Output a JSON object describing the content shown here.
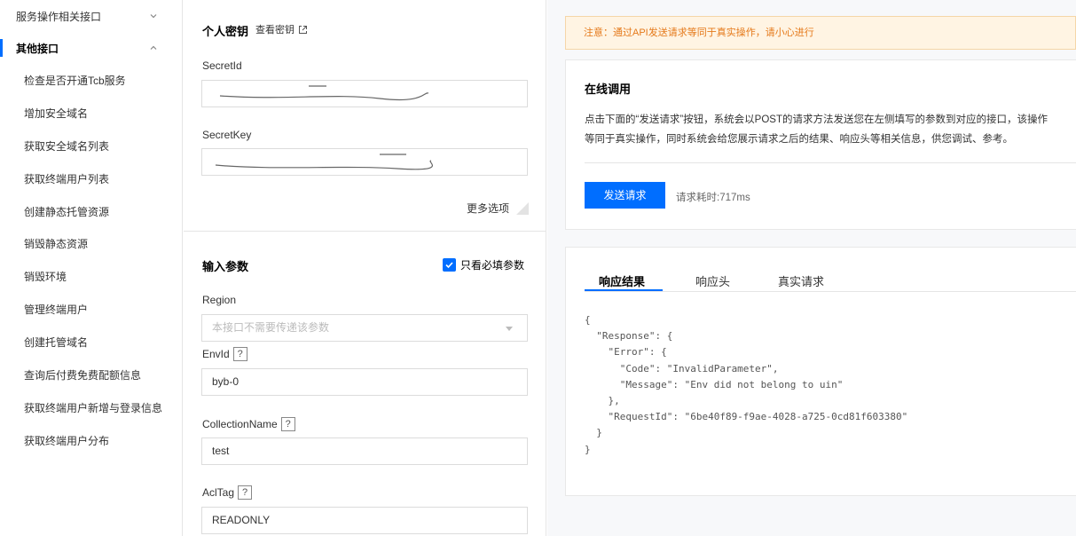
{
  "sidebar": {
    "group1": {
      "label": "服务操作相关接口"
    },
    "group2": {
      "label": "其他接口"
    },
    "items": [
      "检查是否开通Tcb服务",
      "增加安全域名",
      "获取安全域名列表",
      "获取终端用户列表",
      "创建静态托管资源",
      "销毁静态资源",
      "销毁环境",
      "管理终端用户",
      "创建托管域名",
      "查询后付费免费配额信息",
      "获取终端用户新增与登录信息",
      "获取终端用户分布"
    ]
  },
  "keys": {
    "title": "个人密钥",
    "view_link": "查看密钥",
    "secret_id_label": "SecretId",
    "secret_key_label": "SecretKey",
    "more_options": "更多选项"
  },
  "params": {
    "title": "输入参数",
    "required_only": "只看必填参数",
    "region_label": "Region",
    "region_placeholder": "本接口不需要传递该参数",
    "envid_label": "EnvId",
    "envid_value": "byb-0",
    "collection_label": "CollectionName",
    "collection_value": "test",
    "acltag_label": "AclTag",
    "acltag_value": "READONLY",
    "help_mark": "?"
  },
  "right": {
    "notice": "注意：通过API发送请求等同于真实操作，请小心进行",
    "online_title": "在线调用",
    "desc_line1": "点击下面的“发送请求”按钮，系统会以POST的请求方法发送您在左侧填写的参数到对应的接口，该操作",
    "desc_line2": "等同于真实操作，同时系统会给您展示请求之后的结果、响应头等相关信息，供您调试、参考。",
    "send_button": "发送请求",
    "elapsed": "请求耗时:717ms",
    "tabs": [
      "响应结果",
      "响应头",
      "真实请求"
    ],
    "response_body": "{\n  \"Response\": {\n    \"Error\": {\n      \"Code\": \"InvalidParameter\",\n      \"Message\": \"Env did not belong to uin\"\n    },\n    \"RequestId\": \"6be40f89-f9ae-4028-a725-0cd81f603380\"\n  }\n}"
  },
  "colors": {
    "primary": "#006eff",
    "notice_text": "#e5791a",
    "notice_bg": "#fff4e3"
  }
}
